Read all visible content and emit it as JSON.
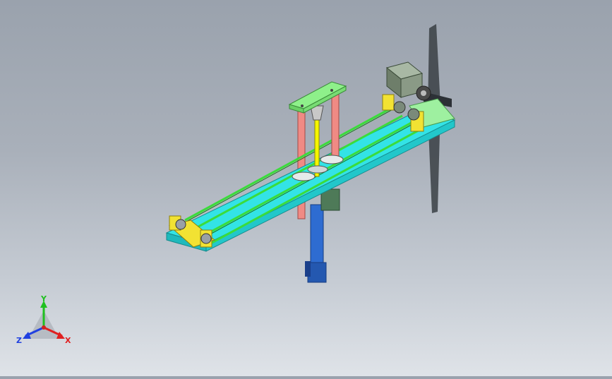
{
  "viewport": {
    "background_top": "#9aa2ad",
    "background_bottom": "#dfe3e8"
  },
  "colors": {
    "base_plate": "#33e3e6",
    "belt": "#3bdc3b",
    "bracket": "#f2e233",
    "top_plate": "#8ef08a",
    "guide_rod": "#f08a84",
    "lead_screw": "#f5f500",
    "lift_cylinder": "#2e6cd1",
    "motor": "#8a9a86",
    "fan_blade": "#3a3f44"
  },
  "triad": {
    "x_label": "X",
    "y_label": "Y",
    "z_label": "Z",
    "x_color": "#e02020",
    "y_color": "#20c020",
    "z_color": "#2040e0",
    "icon": "coordinate-triad-icon"
  }
}
